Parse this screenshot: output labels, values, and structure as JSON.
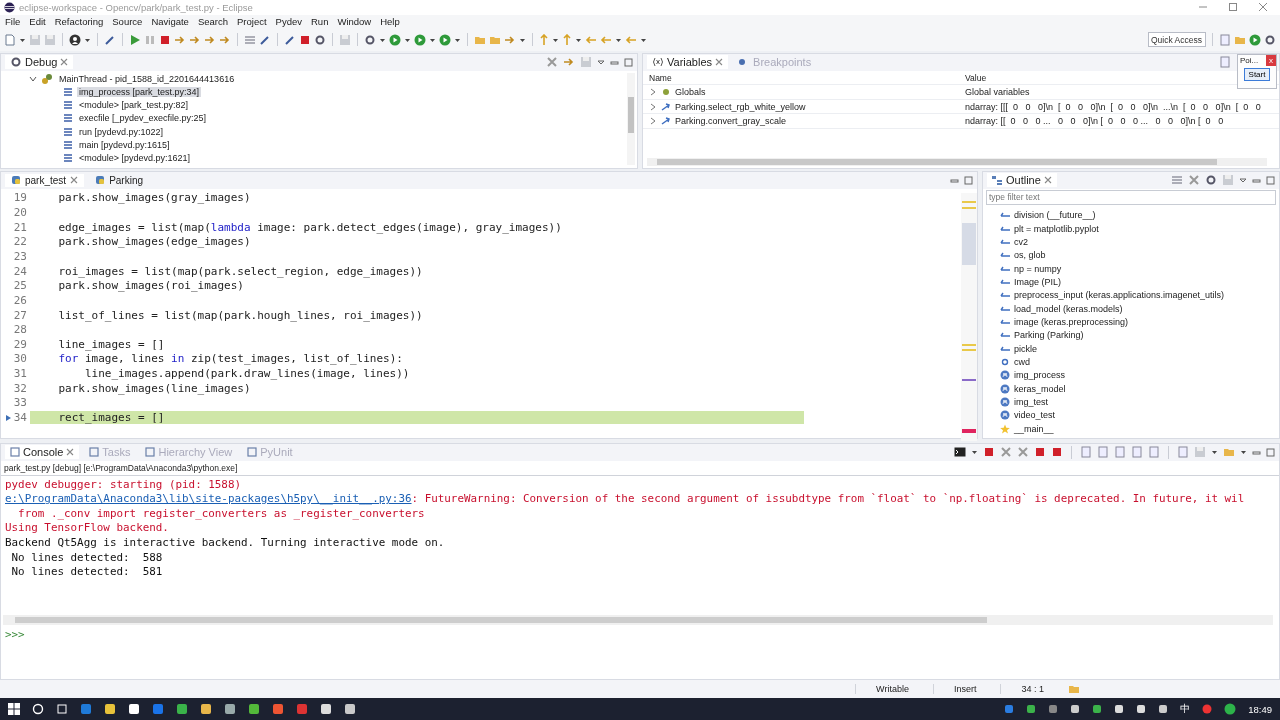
{
  "window": {
    "title": "eclipse-workspace - Opencv/park/park_test.py - Eclipse"
  },
  "menu": [
    "File",
    "Edit",
    "Refactoring",
    "Source",
    "Navigate",
    "Search",
    "Project",
    "Pydev",
    "Run",
    "Window",
    "Help"
  ],
  "quick_access": {
    "placeholder": "Quick Access"
  },
  "debug": {
    "title": "Debug",
    "tree": [
      {
        "label": "MainThread - pid_1588_id_2201644413616",
        "expanded": true,
        "children": [
          {
            "label": "img_process [park_test.py:34]",
            "selected": true
          },
          {
            "label": "<module> [park_test.py:82]",
            "selected": false
          },
          {
            "label": "execfile [_pydev_execfile.py:25]",
            "selected": false
          },
          {
            "label": "run [pydevd.py:1022]",
            "selected": false
          },
          {
            "label": "main [pydevd.py:1615]",
            "selected": false
          },
          {
            "label": "<module> [pydevd.py:1621]",
            "selected": false
          }
        ]
      }
    ]
  },
  "variables": {
    "tabs": [
      {
        "label": "Variables",
        "selected": true
      },
      {
        "label": "Breakpoints",
        "selected": false
      }
    ],
    "columns": [
      "Name",
      "Value"
    ],
    "rows": [
      {
        "kind": "globals",
        "name": "Globals",
        "value": "Global variables"
      },
      {
        "kind": "attribute",
        "name": "Parking.select_rgb_white_yellow",
        "value": "ndarray: [[[  0   0   0]\\n  [  0   0   0]\\n  [  0   0   0]\\n  ...\\n  [  0   0   0]\\n  [  0   0"
      },
      {
        "kind": "attribute",
        "name": "Parking.convert_gray_scale",
        "value": "ndarray: [[  0   0   0 ...   0   0   0]\\n [  0   0   0 ...   0   0   0]\\n [  0   0"
      }
    ]
  },
  "popup": {
    "title": "Poi...",
    "close": "x",
    "button": "Start"
  },
  "editor": {
    "tabs": [
      {
        "label": "park_test",
        "selected": true
      },
      {
        "label": "Parking",
        "selected": false
      }
    ],
    "lines": [
      {
        "number": "19",
        "current": false,
        "segments": [
          {
            "kind": "plain",
            "text": "    park.show_images(gray_images)"
          }
        ]
      },
      {
        "number": "20",
        "current": false
      },
      {
        "number": "21",
        "current": false,
        "segments": [
          {
            "kind": "plain",
            "text": "    edge_images = list(map("
          },
          {
            "kind": "keyword",
            "text": "lambda"
          },
          {
            "kind": "plain",
            "text": " image: park.detect_edges(image), gray_images))"
          }
        ]
      },
      {
        "number": "22",
        "current": false,
        "segments": [
          {
            "kind": "plain",
            "text": "    park.show_images(edge_images)"
          }
        ]
      },
      {
        "number": "23",
        "current": false
      },
      {
        "number": "24",
        "current": false,
        "segments": [
          {
            "kind": "plain",
            "text": "    roi_images = list(map(park.select_region, edge_images))"
          }
        ]
      },
      {
        "number": "25",
        "current": false,
        "segments": [
          {
            "kind": "plain",
            "text": "    park.show_images(roi_images)"
          }
        ]
      },
      {
        "number": "26",
        "current": false
      },
      {
        "number": "27",
        "current": false,
        "segments": [
          {
            "kind": "plain",
            "text": "    list_of_lines = list(map(park.hough_lines, roi_images))"
          }
        ]
      },
      {
        "number": "28",
        "current": false
      },
      {
        "number": "29",
        "current": false,
        "segments": [
          {
            "kind": "plain",
            "text": "    line_images = []"
          }
        ]
      },
      {
        "number": "30",
        "current": false,
        "segments": [
          {
            "kind": "keyword",
            "text": "    for"
          },
          {
            "kind": "plain",
            "text": " image, lines "
          },
          {
            "kind": "keyword",
            "text": "in"
          },
          {
            "kind": "plain",
            "text": " zip(test_images, list_of_lines):"
          }
        ]
      },
      {
        "number": "31",
        "current": false,
        "segments": [
          {
            "kind": "plain",
            "text": "        line_images.append(park.draw_lines(image, lines))"
          }
        ]
      },
      {
        "number": "32",
        "current": false,
        "segments": [
          {
            "kind": "plain",
            "text": "    park.show_images(line_images)"
          }
        ]
      },
      {
        "number": "33",
        "current": false
      },
      {
        "number": "34",
        "current": true,
        "segments": [
          {
            "kind": "plain",
            "text": "    rect_images = []"
          }
        ]
      }
    ]
  },
  "outline": {
    "title": "Outline",
    "placeholder": "type filter text",
    "items": [
      {
        "kind": "import",
        "label": "division (__future__)"
      },
      {
        "kind": "import",
        "label": "plt = matplotlib.pyplot"
      },
      {
        "kind": "import",
        "label": "cv2"
      },
      {
        "kind": "import",
        "label": "os, glob"
      },
      {
        "kind": "import",
        "label": "np = numpy"
      },
      {
        "kind": "import",
        "label": "Image (PIL)"
      },
      {
        "kind": "import",
        "label": "preprocess_input (keras.applications.imagenet_utils)"
      },
      {
        "kind": "import",
        "label": "load_model (keras.models)"
      },
      {
        "kind": "import",
        "label": "image (keras.preprocessing)"
      },
      {
        "kind": "import",
        "label": "Parking (Parking)"
      },
      {
        "kind": "import",
        "label": "pickle"
      },
      {
        "kind": "variable",
        "label": "cwd"
      },
      {
        "kind": "function",
        "label": "img_process"
      },
      {
        "kind": "function",
        "label": "keras_model"
      },
      {
        "kind": "function",
        "label": "img_test"
      },
      {
        "kind": "function",
        "label": "video_test"
      },
      {
        "kind": "main",
        "label": "__main__"
      }
    ]
  },
  "console": {
    "tabs": [
      {
        "label": "Console",
        "selected": true
      },
      {
        "label": "Tasks",
        "selected": false
      },
      {
        "label": "Hierarchy View",
        "selected": false
      },
      {
        "label": "PyUnit",
        "selected": false
      }
    ],
    "process": "park_test.py [debug] [e:\\ProgramData\\Anaconda3\\python.exe]",
    "lines": [
      [
        {
          "kind": "error",
          "text": "pydev debugger: starting (pid: 1588)"
        }
      ],
      [
        {
          "kind": "link",
          "text": "e:\\ProgramData\\Anaconda3\\lib\\site-packages\\h5py\\__init__.py:36"
        },
        {
          "kind": "error",
          "text": ": FutureWarning: Conversion of the second argument of issubdtype from `float` to `np.floating` is deprecated. In future, it wil"
        }
      ],
      [
        {
          "kind": "error",
          "text": "  from ._conv import register_converters as _register_converters"
        }
      ],
      [
        {
          "kind": "error",
          "text": "Using TensorFlow backend."
        }
      ],
      [
        {
          "kind": "plain",
          "text": "Backend Qt5Agg is interactive backend. Turning interactive mode on."
        }
      ],
      [
        {
          "kind": "plain",
          "text": " No lines detected:  588"
        }
      ],
      [
        {
          "kind": "plain",
          "text": " No lines detected:  581"
        }
      ]
    ],
    "prompt": ">>>"
  },
  "status_bar": {
    "items": [
      "Writable",
      "Insert",
      "34 : 1"
    ]
  },
  "taskbar": {
    "ime": "中",
    "time": "18:49"
  }
}
